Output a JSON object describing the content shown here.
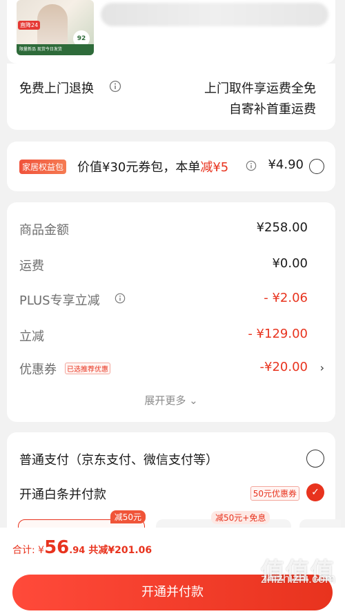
{
  "product": {
    "thumb_badge": "直降24",
    "thumb_score": "92",
    "thumb_strip": "限量新品 现货今日发货"
  },
  "return_service": {
    "label": "免费上门退换",
    "line1": "上门取件享运费全免",
    "line2": "自寄补首重运费"
  },
  "home_pack": {
    "tag": "家居权益包",
    "desc_prefix": "价值¥30元券包，本单",
    "desc_red": "减¥5",
    "price": "¥4.90"
  },
  "amounts": {
    "rows": [
      {
        "label": "商品金额",
        "value": "¥258.00"
      },
      {
        "label": "运费",
        "value": "¥0.00"
      },
      {
        "label": "PLUS专享立减",
        "value": "- ¥2.06"
      },
      {
        "label": "立减",
        "value": "- ¥129.00"
      },
      {
        "label": "优惠券",
        "tag": "已选推荐优惠",
        "value": "-¥20.00",
        "chevron": "›"
      }
    ],
    "expand": "展开更多 ⌄"
  },
  "payment": {
    "option1": "普通支付（京东支付、微信支付等）",
    "option2": "开通白条并付款",
    "coupon_tag": "50元优惠券",
    "plan1_badge": "减50元",
    "plan2_badge": "减50元+免息"
  },
  "bottom_bar": {
    "total_label": "合计: ¥",
    "total_integer": "56",
    "total_decimal": ".94",
    "sum": "共减¥201.06",
    "cta": "开通并付款"
  },
  "watermark": {
    "logo": "值值值",
    "site": "zhizhizhi.com"
  },
  "colors": {
    "accent": "#e8331e",
    "background": "#f2f2f2"
  }
}
